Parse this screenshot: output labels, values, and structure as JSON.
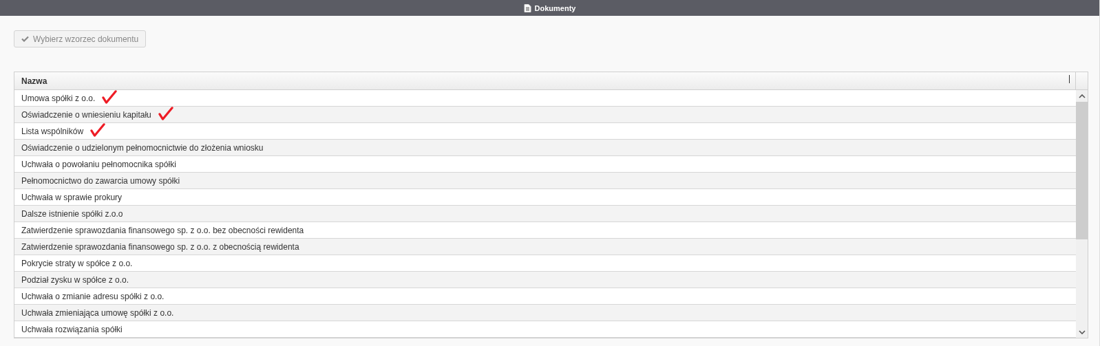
{
  "window": {
    "title": "Dokumenty"
  },
  "toolbar": {
    "button": {
      "label": "Wybierz wzorzec dokumentu",
      "disabled": true
    }
  },
  "table": {
    "columns": [
      "Nazwa"
    ],
    "rows": [
      {
        "name": "Umowa spółki z o.o.",
        "checked": true
      },
      {
        "name": "Oświadczenie o wniesieniu kapitału",
        "checked": true
      },
      {
        "name": "Lista wspólników",
        "checked": true
      },
      {
        "name": "Oświadczenie o udzielonym pełnomocnictwie do złożenia wniosku",
        "checked": false
      },
      {
        "name": "Uchwała o powołaniu pełnomocnika spółki",
        "checked": false
      },
      {
        "name": "Pełnomocnictwo do zawarcia umowy spółki",
        "checked": false
      },
      {
        "name": "Uchwała w sprawie prokury",
        "checked": false
      },
      {
        "name": "Dalsze istnienie spółki z.o.o",
        "checked": false
      },
      {
        "name": "Zatwierdzenie sprawozdania finansowego sp. z o.o. bez obecności rewidenta",
        "checked": false
      },
      {
        "name": "Zatwierdzenie sprawozdania finansowego sp. z o.o. z obecnością rewidenta",
        "checked": false
      },
      {
        "name": "Pokrycie straty w spółce z o.o.",
        "checked": false
      },
      {
        "name": "Podział zysku w spółce z o.o.",
        "checked": false
      },
      {
        "name": "Uchwała o zmianie adresu spółki z o.o.",
        "checked": false
      },
      {
        "name": "Uchwała zmieniająca umowę spółki z o.o.",
        "checked": false
      },
      {
        "name": "Uchwała rozwiązania spółki",
        "checked": false
      }
    ]
  }
}
